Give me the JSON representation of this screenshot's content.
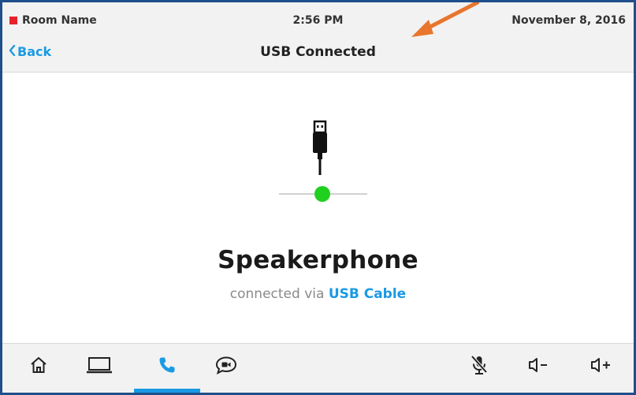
{
  "status_bar": {
    "room_name": "Room Name",
    "time": "2:56 PM",
    "date": "November 8, 2016",
    "room_indicator_color": "#e8212b"
  },
  "nav": {
    "back_label": "Back",
    "title": "USB Connected"
  },
  "content": {
    "device_name": "Speakerphone",
    "connection_prefix": "connected via",
    "connection_method": "USB Cable",
    "status_dot_color": "#1fd01f",
    "icon": "usb-plug-icon"
  },
  "toolbar": {
    "active_item": "call",
    "items": [
      {
        "name": "home",
        "icon": "home-icon"
      },
      {
        "name": "laptop",
        "icon": "laptop-icon"
      },
      {
        "name": "call",
        "icon": "phone-icon"
      },
      {
        "name": "video-chat",
        "icon": "video-chat-icon"
      },
      {
        "name": "mic-mute",
        "icon": "mic-mute-icon"
      },
      {
        "name": "volume-down",
        "icon": "volume-down-icon"
      },
      {
        "name": "volume-up",
        "icon": "volume-up-icon"
      }
    ]
  },
  "colors": {
    "accent": "#1a9ae4",
    "frame_border": "#1f4f8a",
    "annotation_arrow": "#e8762c"
  }
}
